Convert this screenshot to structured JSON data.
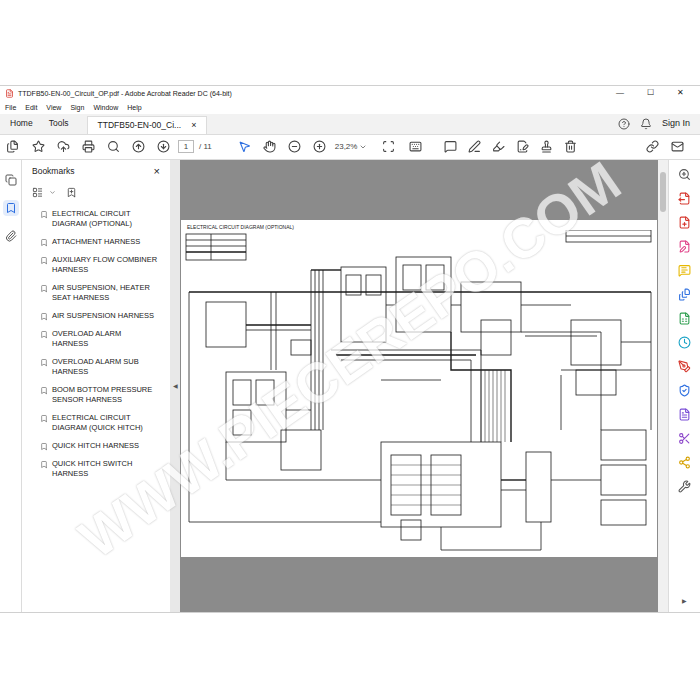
{
  "window": {
    "title": "TTDFB50-EN-00_Circuit_OP.pdf - Adobe Acrobat Reader DC (64-bit)",
    "controls": [
      "—",
      "☐",
      "✕"
    ]
  },
  "menu": [
    "File",
    "Edit",
    "View",
    "Sign",
    "Window",
    "Help"
  ],
  "tabs": [
    {
      "label": "Home",
      "selected": false
    },
    {
      "label": "Tools",
      "selected": false
    },
    {
      "label": "TTDFB50-EN-00_Ci...",
      "selected": true
    }
  ],
  "tab_close": "×",
  "account": {
    "sign_in": "Sign In"
  },
  "toolbar": {
    "page_current": "1",
    "page_total": "/ 11",
    "zoom": "23,2%"
  },
  "left_rail": [
    {
      "selected": false
    },
    {
      "selected": true
    },
    {
      "selected": false
    }
  ],
  "sidebar": {
    "title": "Bookmarks",
    "close": "×",
    "items": [
      {
        "label": "ELECTRICAL CIRCUIT DIAGRAM (OPTIONAL)"
      },
      {
        "label": "ATTACHMENT HARNESS"
      },
      {
        "label": "AUXILIARY FLOW COMBINER HARNESS"
      },
      {
        "label": "AIR SUSPENSION, HEATER SEAT HARNESS"
      },
      {
        "label": "AIR SUSPENSION HARNESS"
      },
      {
        "label": "OVERLOAD ALARM HARNESS"
      },
      {
        "label": "OVERLOAD ALARM SUB HARNESS"
      },
      {
        "label": "BOOM BOTTOM PRESSURE SENSOR HARNESS"
      },
      {
        "label": "ELECTRICAL CIRCUIT DIAGRAM (QUICK HITCH)"
      },
      {
        "label": "QUICK HITCH HARNESS"
      },
      {
        "label": "QUICK HITCH SWITCH HARNESS"
      }
    ]
  },
  "document": {
    "page_title": "ELECTRICAL CIRCUIT DIAGRAM (OPTIONAL)",
    "collapse_left": "◀",
    "collapse_right": "▶"
  },
  "watermark": "WWW.PIECEREPO.COM"
}
